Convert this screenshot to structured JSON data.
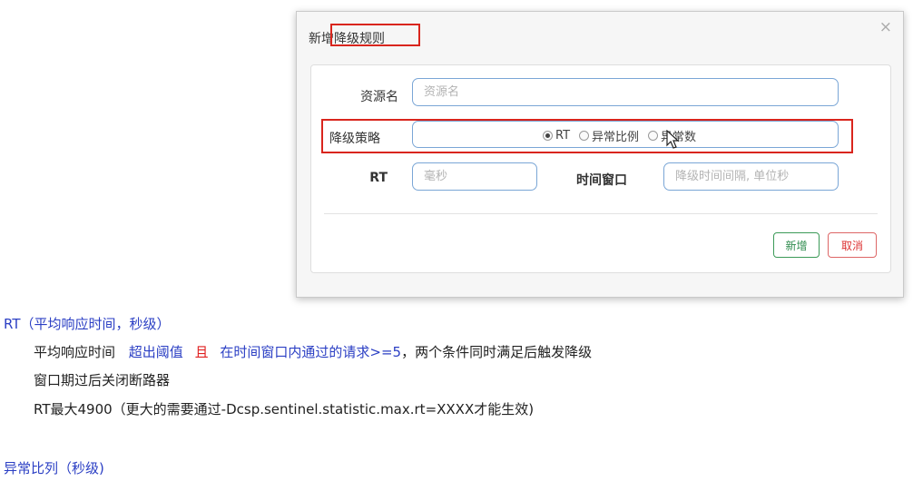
{
  "dialog": {
    "title": "新增降级规则",
    "close_symbol": "×",
    "resource_label": "资源名",
    "resource_placeholder": "资源名",
    "strategy_label": "降级策略",
    "strategy_options": [
      "RT",
      "异常比例",
      "异常数"
    ],
    "strategy_selected": "RT",
    "rt_label": "RT",
    "rt_placeholder": "毫秒",
    "window_label": "时间窗口",
    "window_placeholder": "降级时间间隔, 单位秒",
    "add_button": "新增",
    "cancel_button": "取消"
  },
  "notes": {
    "rt_heading": "RT（平均响应时间，秒级）",
    "line1_a": "平均响应时间",
    "line1_b": "超出阈值",
    "line1_c": "且",
    "line1_d": "在时间窗口内通过的请求>=5",
    "line1_e": "，两个条件同时满足后触发降级",
    "line2": "窗口期过后关闭断路器",
    "line3": "RT最大4900（更大的需要通过-Dcsp.sentinel.statistic.max.rt=XXXX才能生效)",
    "ratio_heading": "异常比列（秒级)"
  },
  "colors": {
    "highlight": "#d9251d",
    "note_blue": "#2b3fc4",
    "note_red": "#e02020",
    "add_green": "#3c9a58",
    "cancel_red": "#dd3333"
  }
}
